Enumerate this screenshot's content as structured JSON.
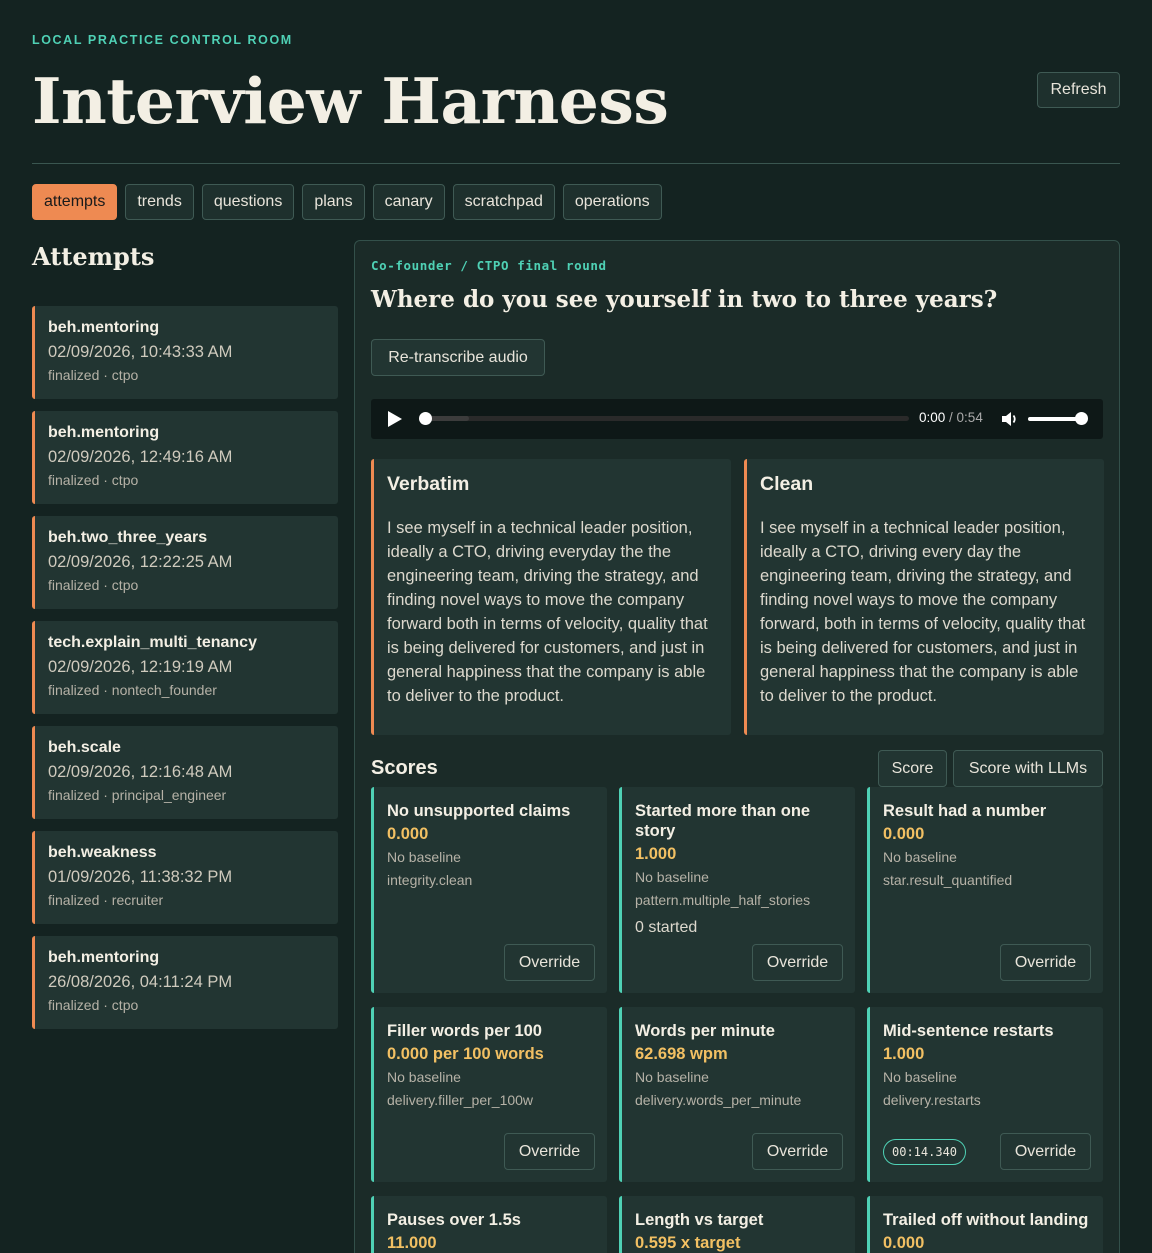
{
  "header": {
    "eyebrow": "LOCAL PRACTICE CONTROL ROOM",
    "title": "Interview Harness",
    "refresh_label": "Refresh"
  },
  "tabs": [
    {
      "label": "attempts",
      "active": true
    },
    {
      "label": "trends"
    },
    {
      "label": "questions"
    },
    {
      "label": "plans"
    },
    {
      "label": "canary"
    },
    {
      "label": "scratchpad"
    },
    {
      "label": "operations"
    }
  ],
  "sidebar": {
    "title": "Attempts",
    "attempts": [
      {
        "id": "beh.mentoring",
        "timestamp": "02/09/2026, 10:43:33 AM",
        "meta": "finalized · ctpo"
      },
      {
        "id": "beh.mentoring",
        "timestamp": "02/09/2026, 12:49:16 AM",
        "meta": "finalized · ctpo"
      },
      {
        "id": "beh.two_three_years",
        "timestamp": "02/09/2026, 12:22:25 AM",
        "meta": "finalized · ctpo"
      },
      {
        "id": "tech.explain_multi_tenancy",
        "timestamp": "02/09/2026, 12:19:19 AM",
        "meta": "finalized · nontech_founder"
      },
      {
        "id": "beh.scale",
        "timestamp": "02/09/2026, 12:16:48 AM",
        "meta": "finalized · principal_engineer"
      },
      {
        "id": "beh.weakness",
        "timestamp": "01/09/2026, 11:38:32 PM",
        "meta": "finalized · recruiter"
      },
      {
        "id": "beh.mentoring",
        "timestamp": "26/08/2026, 04:11:24 PM",
        "meta": "finalized · ctpo"
      }
    ]
  },
  "detail": {
    "round_label": "Co-founder / CTPO final round",
    "question": "Where do you see yourself in two to three years?",
    "retranscribe_label": "Re-transcribe audio",
    "player": {
      "current": "0:00",
      "separator": " / ",
      "duration": "0:54",
      "progress": 0.0,
      "volume": 1.0
    },
    "verbatim": {
      "title": "Verbatim",
      "text": "I see myself in a technical leader position, ideally a CTO, driving everyday the the engineering team, driving the strategy, and finding novel ways to move the company forward both in terms of velocity, quality that is being delivered for customers, and just in general happiness that the company is able to deliver to the product."
    },
    "clean": {
      "title": "Clean",
      "text": "I see myself in a technical leader position, ideally a CTO, driving every day the engineering team, driving the strategy, and finding novel ways to move the company forward, both in terms of velocity, quality that is being delivered for customers, and just in general happiness that the company is able to deliver to the product."
    },
    "scores_title": "Scores",
    "score_label": "Score",
    "score_llm_label": "Score with LLMs",
    "override_label": "Override",
    "cards": [
      {
        "title": "No unsupported claims",
        "value": "0.000",
        "baseline": "No baseline",
        "key": "integrity.clean"
      },
      {
        "title": "Started more than one story",
        "value": "1.000",
        "baseline": "No baseline",
        "key": "pattern.multiple_half_stories",
        "extra": "0 started"
      },
      {
        "title": "Result had a number",
        "value": "0.000",
        "baseline": "No baseline",
        "key": "star.result_quantified"
      },
      {
        "title": "Filler words per 100",
        "value": "0.000 per 100 words",
        "baseline": "No baseline",
        "key": "delivery.filler_per_100w"
      },
      {
        "title": "Words per minute",
        "value": "62.698 wpm",
        "baseline": "No baseline",
        "key": "delivery.words_per_minute"
      },
      {
        "title": "Mid-sentence restarts",
        "value": "1.000",
        "baseline": "No baseline",
        "key": "delivery.restarts",
        "chip": "00:14.340"
      },
      {
        "title": "Pauses over 1.5s",
        "value": "11.000"
      },
      {
        "title": "Length vs target",
        "value": "0.595 x target"
      },
      {
        "title": "Trailed off without landing",
        "value": "0.000"
      }
    ],
    "colors": {
      "accent": "#ee8a52",
      "teal": "#4fd1b5",
      "value": "#f2c063"
    }
  }
}
